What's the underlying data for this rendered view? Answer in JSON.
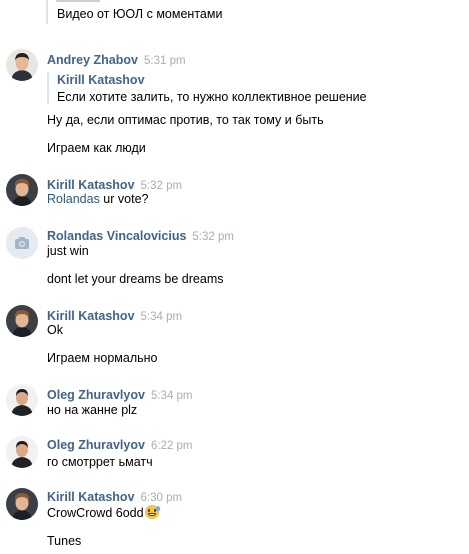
{
  "top_fragment": {
    "text": "Видео от ЮОЛ с моментами"
  },
  "messages": [
    {
      "author": "Andrey Zhabov",
      "time": "5:31 pm",
      "avatar": "andrey",
      "quote": {
        "author": "Kirill Katashov",
        "text": "Если хотите залить, то нужно коллективное решение"
      },
      "lines": [
        "Ну да, если оптимас против, то так тому и быть",
        "Играем как люди"
      ]
    },
    {
      "author": "Kirill Katashov",
      "time": "5:32 pm",
      "avatar": "kirill",
      "mention": "Rolandas",
      "mention_rest": " ur vote?"
    },
    {
      "author": "Rolandas Vincalovicius",
      "time": "5:32 pm",
      "avatar": "camera-placeholder",
      "lines": [
        "just win",
        "dont let your dreams be dreams"
      ]
    },
    {
      "author": "Kirill Katashov",
      "time": "5:34 pm",
      "avatar": "kirill",
      "lines": [
        "Ok",
        "Играем нормально"
      ]
    },
    {
      "author": "Oleg Zhuravlyov",
      "time": "5:34 pm",
      "avatar": "oleg",
      "lines": [
        "но на жанне plz"
      ]
    },
    {
      "author": "Oleg Zhuravlyov",
      "time": "6:22 pm",
      "avatar": "oleg",
      "lines": [
        "го смотррет ьматч"
      ]
    },
    {
      "author": "Kirill Katashov",
      "time": "6:30 pm",
      "avatar": "kirill",
      "lines": [
        "CrowCrowd 6odd",
        "Tunes"
      ],
      "emoji": "grinning-sweat-emoji"
    }
  ],
  "colors": {
    "author": "#42648b",
    "time": "#a7aeb6",
    "link": "#2a5885",
    "quote_bar": "#dfe4ea"
  }
}
